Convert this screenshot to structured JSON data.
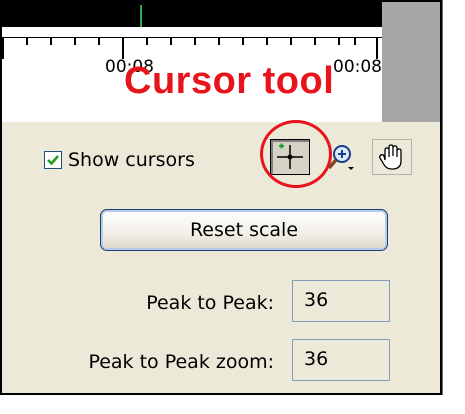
{
  "timeline": {
    "time_left": "00:08",
    "time_right": "00:08"
  },
  "annotation": {
    "text": "Cursor tool",
    "color": "#e8141b"
  },
  "toolbar": {
    "show_cursors_label": "Show cursors",
    "show_cursors_checked": true,
    "tools": [
      {
        "name": "cursor-tool",
        "icon": "crosshair-icon",
        "selected": true
      },
      {
        "name": "zoom-tool",
        "icon": "magnifier-plus-icon",
        "selected": false
      },
      {
        "name": "pan-tool",
        "icon": "hand-icon",
        "selected": false
      }
    ]
  },
  "reset_button": {
    "label": "Reset scale"
  },
  "stats": {
    "peak_label": "Peak to Peak:",
    "peak_value": "36",
    "peak_zoom_label": "Peak to Peak zoom:",
    "peak_zoom_value": "36"
  }
}
